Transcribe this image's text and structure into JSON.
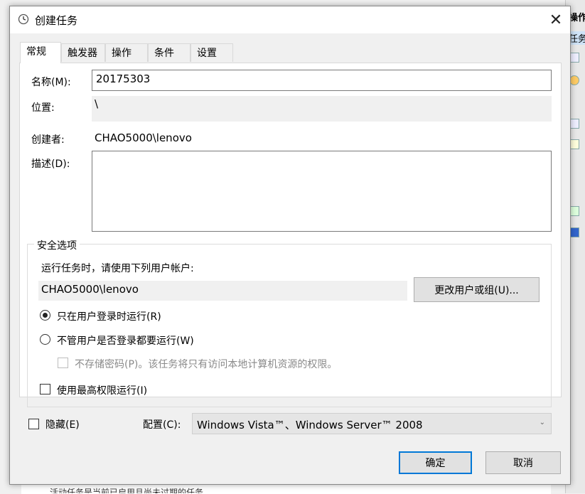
{
  "background": {
    "right_header": "操作",
    "right_sub": "任务",
    "bottom_text": "活动任务是当前已启用且尚未过期的任务。"
  },
  "dialog": {
    "title": "创建任务",
    "close_symbol": "✕"
  },
  "tabs": [
    {
      "label": "常规",
      "active": true
    },
    {
      "label": "触发器",
      "active": false
    },
    {
      "label": "操作",
      "active": false
    },
    {
      "label": "条件",
      "active": false
    },
    {
      "label": "设置",
      "active": false
    }
  ],
  "general": {
    "name_label": "名称(M):",
    "name_value": "20175303",
    "location_label": "位置:",
    "location_value": "\\",
    "author_label": "创建者:",
    "author_value": "CHAO5000\\lenovo",
    "description_label": "描述(D):",
    "description_value": ""
  },
  "security": {
    "group_title": "安全选项",
    "run_as_label": "运行任务时，请使用下列用户帐户:",
    "run_as_value": "CHAO5000\\lenovo",
    "change_user_button": "更改用户或组(U)...",
    "radio_logged_on": "只在用户登录时运行(R)",
    "radio_logged_on_checked": true,
    "radio_whether_logged": "不管用户是否登录都要运行(W)",
    "radio_whether_logged_checked": false,
    "no_store_password": "不存储密码(P)。该任务将只有访问本地计算机资源的权限。",
    "no_store_password_checked": false,
    "highest_privileges": "使用最高权限运行(I)",
    "highest_privileges_checked": false
  },
  "footer": {
    "hidden_label": "隐藏(E)",
    "hidden_checked": false,
    "configure_label": "配置(C):",
    "configure_value": "Windows Vista™、Windows Server™ 2008",
    "ok_button": "确定",
    "cancel_button": "取消"
  }
}
